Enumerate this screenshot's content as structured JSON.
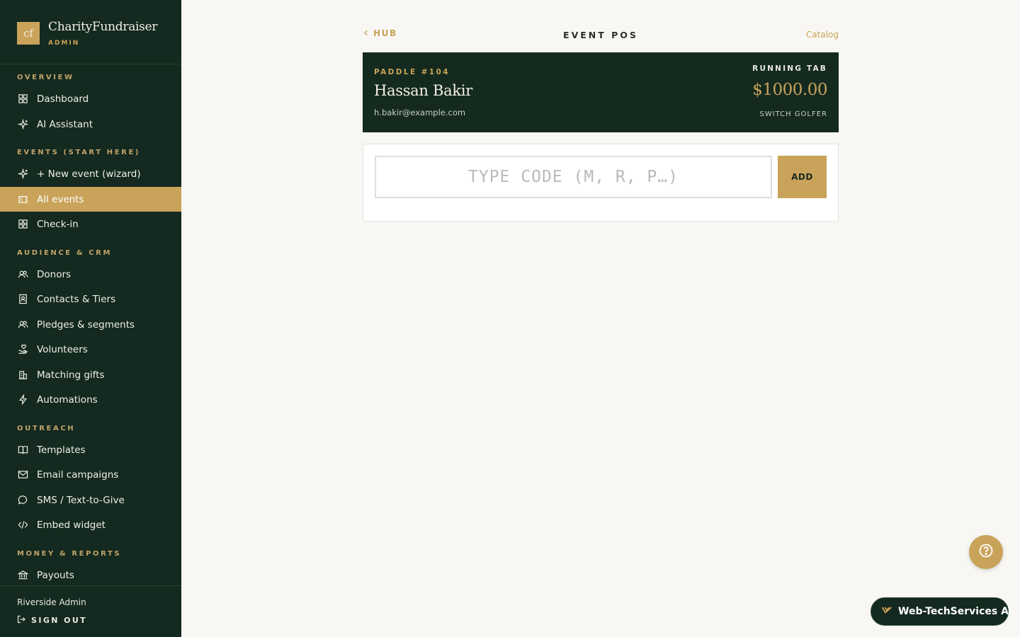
{
  "brand": {
    "logo_text": "cf",
    "name": "CharityFundraiser",
    "subtitle": "ADMIN"
  },
  "sidebar": {
    "sections": [
      {
        "title": "OVERVIEW",
        "items": [
          {
            "label": "Dashboard",
            "icon": "grid-icon"
          },
          {
            "label": "AI Assistant",
            "icon": "sparkle-icon"
          }
        ]
      },
      {
        "title": "EVENTS (START HERE)",
        "items": [
          {
            "label": "+ New event (wizard)",
            "icon": "sparkle-icon"
          },
          {
            "label": "All events",
            "icon": "ticket-icon",
            "active": true
          },
          {
            "label": "Check-in",
            "icon": "grid-icon"
          }
        ]
      },
      {
        "title": "AUDIENCE & CRM",
        "items": [
          {
            "label": "Donors",
            "icon": "users-icon"
          },
          {
            "label": "Contacts & Tiers",
            "icon": "contact-card-icon"
          },
          {
            "label": "Pledges & segments",
            "icon": "users-icon"
          },
          {
            "label": "Volunteers",
            "icon": "hand-heart-icon"
          },
          {
            "label": "Matching gifts",
            "icon": "building-icon"
          },
          {
            "label": "Automations",
            "icon": "bolt-icon"
          }
        ]
      },
      {
        "title": "OUTREACH",
        "items": [
          {
            "label": "Templates",
            "icon": "book-icon"
          },
          {
            "label": "Email campaigns",
            "icon": "mail-icon"
          },
          {
            "label": "SMS / Text-to-Give",
            "icon": "chat-bubble-icon"
          },
          {
            "label": "Embed widget",
            "icon": "code-icon"
          }
        ]
      },
      {
        "title": "MONEY & REPORTS",
        "items": [
          {
            "label": "Payouts",
            "icon": "bank-icon"
          }
        ]
      }
    ],
    "user_name": "Riverside Admin",
    "sign_out_label": "SIGN OUT"
  },
  "header": {
    "back_label": "HUB",
    "title": "EVENT POS",
    "catalog_label": "Catalog"
  },
  "tab_card": {
    "paddle": "PADDLE #104",
    "donor_name": "Hassan Bakir",
    "donor_email": "h.bakir@example.com",
    "tab_label": "RUNNING TAB",
    "tab_amount": "$1000.00",
    "switch_label": "SWITCH GOLFER"
  },
  "entry": {
    "placeholder": "TYPE CODE (M, R, P…)",
    "value": "",
    "add_label": "ADD"
  },
  "floating": {
    "ai_label": "Web-TechServices AI"
  },
  "colors": {
    "sidebar_bg": "#14291f",
    "accent_gold": "#c9a35a",
    "page_bg": "#f8f7f3"
  }
}
